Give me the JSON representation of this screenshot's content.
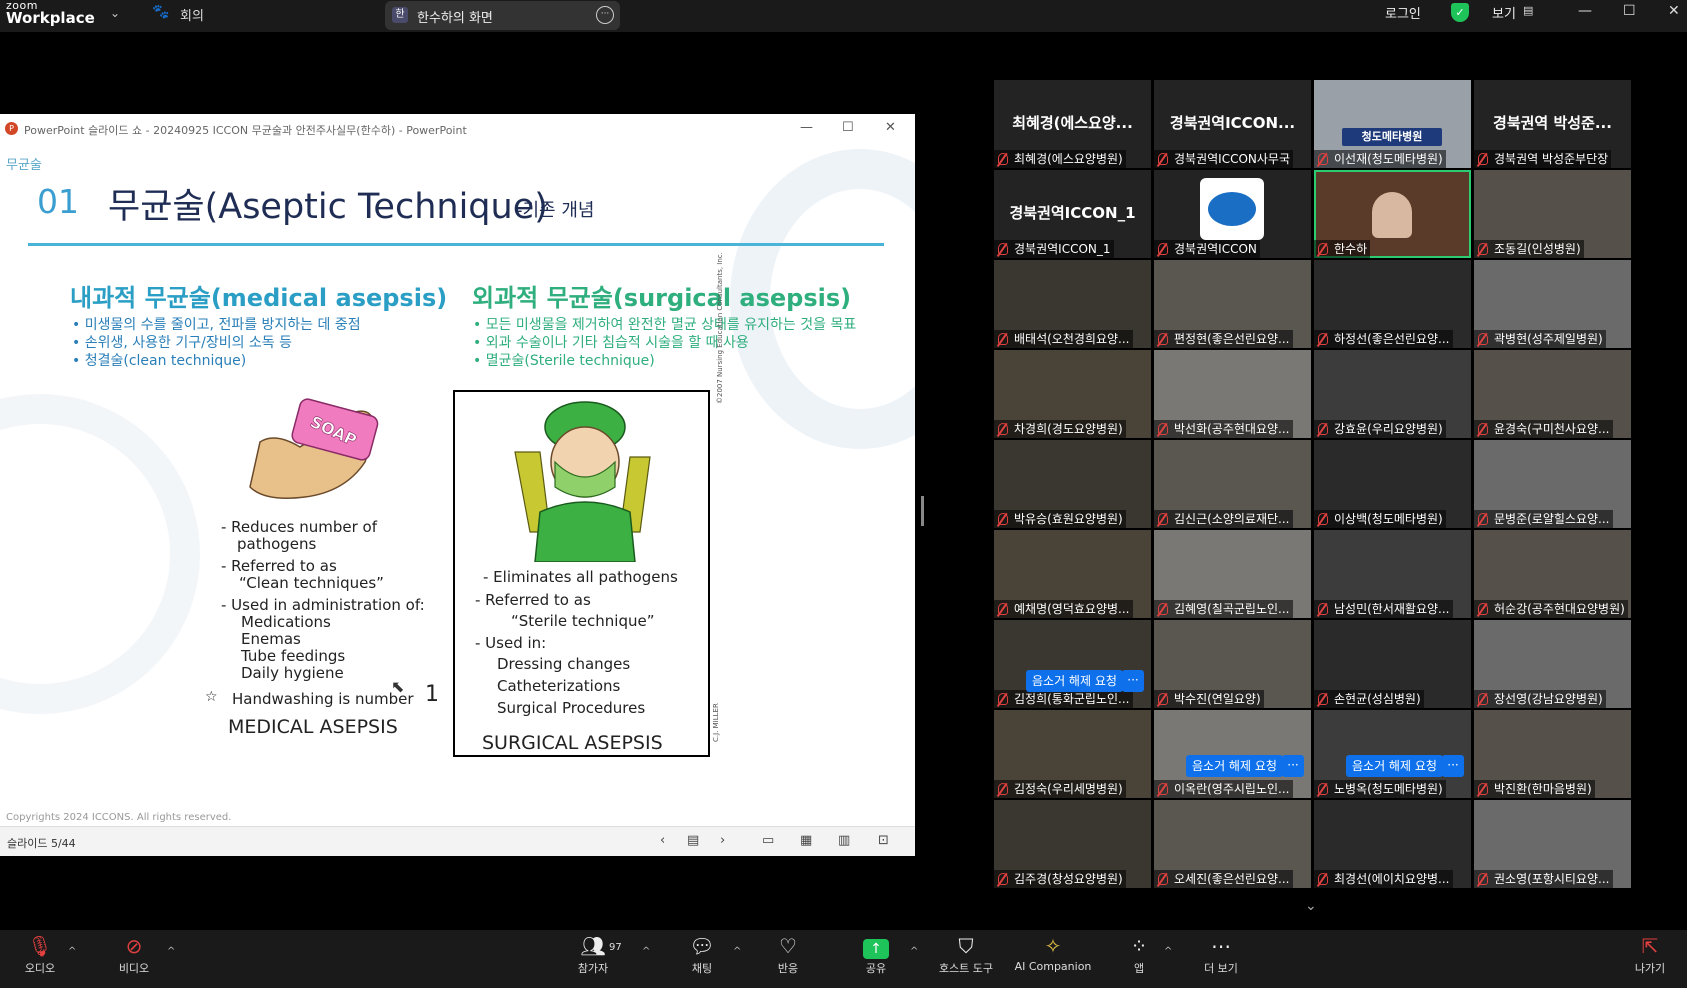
{
  "topbar": {
    "logo_line1": "zoom",
    "logo_line2": "Workplace",
    "meeting_label": "회의",
    "share_badge": "한",
    "share_title": "한수하의 화면",
    "login": "로그인",
    "view": "보기"
  },
  "ppt": {
    "window_title": "PowerPoint 슬라이드 쇼  -  20240925 ICCON 무균술과 안전주사실무(한수하) - PowerPoint",
    "status_slide": "슬라이드 5/44",
    "slide": {
      "crumb": "무균술",
      "number": "01",
      "title": "무균술(Aseptic Technique)",
      "subtitle": "-기존 개념",
      "medical_heading": "내과적 무균술(medical asepsis)",
      "medical_bullets": [
        "미생물의 수를 줄이고, 전파를 방지하는 데 중점",
        "손위생, 사용한 기구/장비의 소독 등",
        "청결술(clean technique)"
      ],
      "surgical_heading": "외과적 무균술(surgical asepsis)",
      "surgical_bullets": [
        "모든 미생물을 제거하여 완전한 멸균 상태를 유지하는 것을 목표",
        "외과 수술이나 기타 침습적 시술을 할 때 사용",
        "멸균술(Sterile technique)"
      ],
      "soap_text": "SOAP",
      "med_lines": [
        "- Reduces number of",
        "pathogens",
        "- Referred to as",
        "“Clean techniques”",
        "- Used in administration of:",
        "Medications",
        "Enemas",
        "Tube feedings",
        "Daily hygiene"
      ],
      "handwash": "Handwashing is number",
      "handwash_num": "1",
      "med_caption": "MEDICAL ASEPSIS",
      "sur_lines": [
        "- Eliminates all pathogens",
        "- Referred to as",
        "“Sterile technique”",
        "- Used in:",
        "Dressing changes",
        "Catheterizations",
        "Surgical Procedures"
      ],
      "sur_caption": "SURGICAL ASEPSIS",
      "side_credit": "©2007 Nursing Education Consultants, Inc.",
      "signature": "C.J. MILLER",
      "copyright": "Copyrights 2024 ICCONS. All rights reserved."
    }
  },
  "gallery": {
    "tiles": [
      {
        "bg": "최혜경(에스요양...",
        "name": "최혜경(에스요양병원)"
      },
      {
        "bg": "경북권역ICCON...",
        "name": "경북권역ICCON사무국"
      },
      {
        "bg": "",
        "name": "이선재(청도메타병원)",
        "sign": "청도메타병원"
      },
      {
        "bg": "경북권역 박성준...",
        "name": "경북권역 박성준부단장"
      },
      {
        "bg": "경북권역ICCON_1",
        "name": "경북권역ICCON_1"
      },
      {
        "bg": "",
        "name": "경북권역ICCON",
        "logo": true
      },
      {
        "bg": "",
        "name": "한수하",
        "active": true
      },
      {
        "bg": "",
        "name": "조동길(인성병원)"
      },
      {
        "bg": "",
        "name": "배태석(오천경희요양..."
      },
      {
        "bg": "",
        "name": "편정현(좋은선린요양..."
      },
      {
        "bg": "",
        "name": "하정선(좋은선린요양..."
      },
      {
        "bg": "",
        "name": "곽병현(성주제일병원)"
      },
      {
        "bg": "",
        "name": "차경희(경도요양병원)"
      },
      {
        "bg": "",
        "name": "박선화(공주현대요양..."
      },
      {
        "bg": "",
        "name": "강효윤(우리요양병원)"
      },
      {
        "bg": "",
        "name": "윤경숙(구미천사요양..."
      },
      {
        "bg": "",
        "name": "박유승(효원요양병원)"
      },
      {
        "bg": "",
        "name": "김신근(소양의료재단..."
      },
      {
        "bg": "",
        "name": "이상백(청도메타병원)"
      },
      {
        "bg": "",
        "name": "문병준(로얄힐스요양..."
      },
      {
        "bg": "",
        "name": "예채명(영덕효요양병..."
      },
      {
        "bg": "",
        "name": "김혜영(칠곡군립노인..."
      },
      {
        "bg": "",
        "name": "남성민(한서재활요양..."
      },
      {
        "bg": "",
        "name": "허순강(공주현대요양병원)"
      },
      {
        "bg": "",
        "name": "김정희(통화군립노인..."
      },
      {
        "bg": "",
        "name": "박수진(연일요양)"
      },
      {
        "bg": "",
        "name": "손현균(성심병원)"
      },
      {
        "bg": "",
        "name": "장선영(강남요양병원)"
      },
      {
        "bg": "",
        "name": "김정숙(우리세명병원)"
      },
      {
        "bg": "",
        "name": "이옥란(영주시립노인..."
      },
      {
        "bg": "",
        "name": "노병옥(청도메타병원)"
      },
      {
        "bg": "",
        "name": "박진환(한마음병원)"
      },
      {
        "bg": "",
        "name": "김주경(창성요양병원)"
      },
      {
        "bg": "",
        "name": "오세진(좋은선린요양..."
      },
      {
        "bg": "",
        "name": "최경선(에이치요양병..."
      },
      {
        "bg": "",
        "name": "권소영(포항시티요양..."
      }
    ],
    "unmute_request": "음소거 해제 요청",
    "more": "···"
  },
  "toolbar": {
    "audio": "오디오",
    "video": "비디오",
    "participants": "참가자",
    "participants_count": "97",
    "chat": "채팅",
    "reactions": "반응",
    "share": "공유",
    "host_tools": "호스트 도구",
    "ai": "AI Companion",
    "apps": "앱",
    "more": "더 보기",
    "leave": "나가기"
  },
  "colors": {
    "zoom_blue": "#0e71eb",
    "share_green": "#1ec35a",
    "slide_title": "#1f2d55",
    "medical": "#2a9ec4",
    "surgical": "#2fae7e"
  }
}
